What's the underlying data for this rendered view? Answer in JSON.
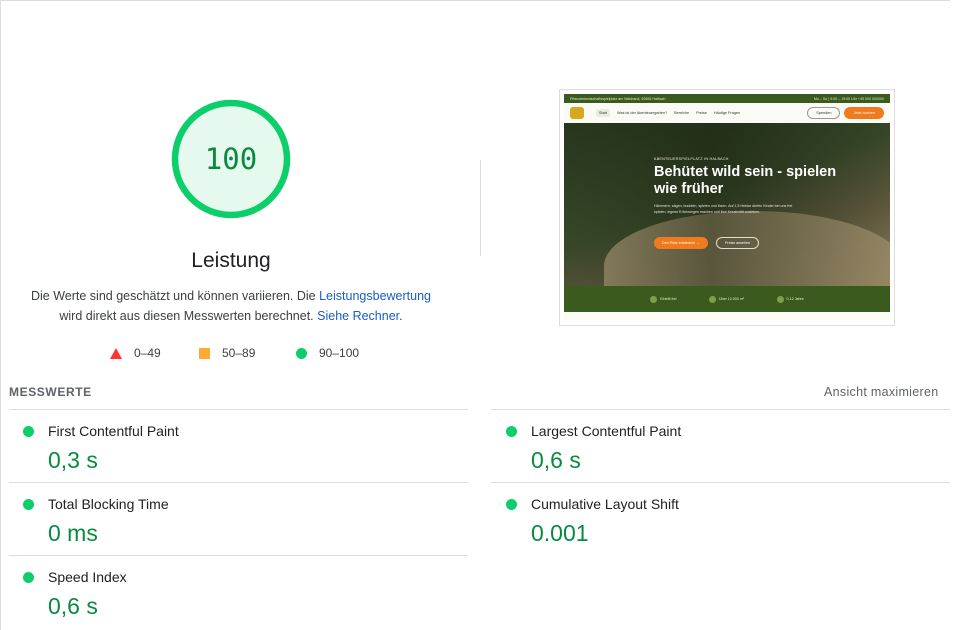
{
  "score": {
    "value": "100",
    "fraction": 1.0,
    "title": "Leistung",
    "colors": {
      "ring": "#0cce6b",
      "fill": "#e6f9ee",
      "text": "#0a8a3f"
    }
  },
  "description": {
    "part1": "Die Werte sind geschätzt und können variieren. Die ",
    "link1": "Leistungsbewertung",
    "part2": "wird direkt aus diesen Messwerten berechnet. ",
    "link2": "Siehe Rechner",
    "part3": "."
  },
  "legend": [
    {
      "range": "0–49",
      "shape": "triangle",
      "color": "#ff3333"
    },
    {
      "range": "50–89",
      "shape": "square",
      "color": "#ffaa33"
    },
    {
      "range": "90–100",
      "shape": "circle",
      "color": "#0cce6b"
    }
  ],
  "preview": {
    "topbar_left": "Pflanzenlandschaftsspielplatz am Waldrand, 92654 Halbach",
    "topbar_right": "Mo – So | 9:00 – 19:00 Uhr   +49 000 000000",
    "nav_items": [
      "Start",
      "Was ist der Abenteuergarten?",
      "Bereiche",
      "Preise",
      "Häufige Fragen"
    ],
    "nav_button_outline": "Spenden",
    "nav_button": "Jetzt buchen",
    "kicker": "ABENTEUERSPIELPLATZ IN HALBACH",
    "title": "Behütet wild sein - spielen wie früher",
    "text": "Hämmern, sägen, buddeln, spielen und lösen. Auf 1,5 Hektar dürfen Kinder bei uns frei spielen, eigene Erfahrungen machen und ihre Kreativität ausleben.",
    "button_primary": "Den Platz entdecken  →",
    "button_secondary": "Preise ansehen",
    "band": [
      "Eintritt frei",
      "Über 12.000 m²",
      "0-12 Jahre"
    ]
  },
  "metrics": {
    "section_title": "MESSWERTE",
    "expand_label": "Ansicht maximieren",
    "items": [
      {
        "label": "First Contentful Paint",
        "value": "0,3 s"
      },
      {
        "label": "Largest Contentful Paint",
        "value": "0,6 s"
      },
      {
        "label": "Total Blocking Time",
        "value": "0 ms"
      },
      {
        "label": "Cumulative Layout Shift",
        "value": "0.001"
      },
      {
        "label": "Speed Index",
        "value": "0,6 s"
      }
    ]
  }
}
